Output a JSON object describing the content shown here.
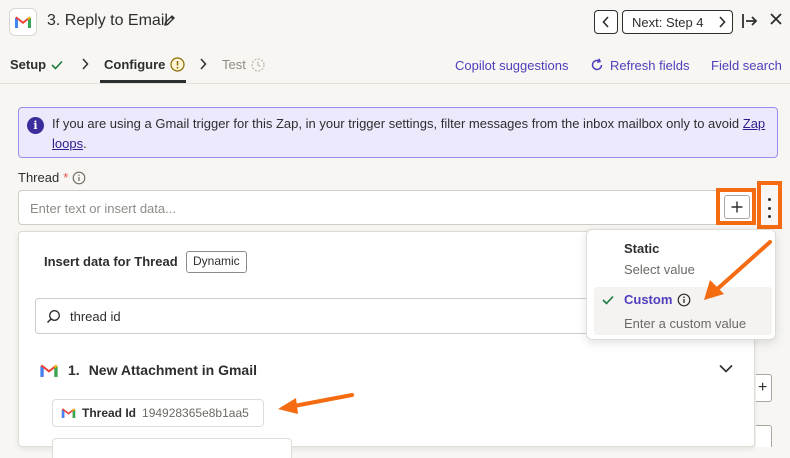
{
  "header": {
    "step_title": "3. Reply to Email",
    "next_label": "Next: Step 4",
    "app_icon": "gmail-icon"
  },
  "tabs": [
    {
      "label": "Setup",
      "status": "check"
    },
    {
      "label": "Configure",
      "status": "warning"
    },
    {
      "label": "Test",
      "status": "pending"
    }
  ],
  "toolbar": {
    "copilot_label": "Copilot suggestions",
    "refresh_label": "Refresh fields",
    "search_label": "Field search"
  },
  "info": {
    "text_before": "If you are using a Gmail trigger for this Zap, in your trigger settings, filter messages from the inbox mailbox only to avoid ",
    "link_part1": "Zap",
    "link_part2": "loops",
    "text_after": "."
  },
  "field": {
    "label": "Thread",
    "required_mark": "*",
    "placeholder": "Enter text or insert data..."
  },
  "panel": {
    "title": "Insert data for Thread",
    "badge": "Dynamic",
    "search_value": "thread id",
    "step_number": "1.",
    "step_name": "New Attachment in Gmail",
    "item_name": "Thread Id",
    "item_value": "194928365e8b1aa5"
  },
  "dropdown": {
    "options": [
      {
        "title": "Static",
        "subtitle": "Select value"
      },
      {
        "title": "Custom",
        "subtitle": "Enter a custom value",
        "selected": true
      }
    ]
  },
  "colors": {
    "accent": "#503ebd",
    "highlight": "#f56b11",
    "info_bg": "#ede9fd"
  }
}
